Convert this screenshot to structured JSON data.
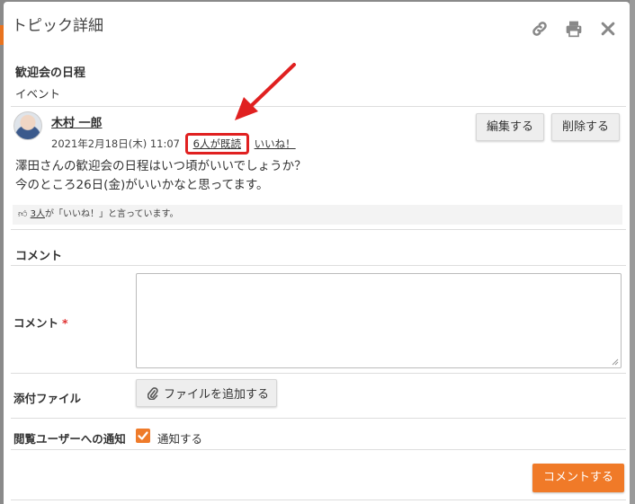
{
  "modal": {
    "title": "トピック詳細",
    "icons": [
      "link-icon",
      "print-icon",
      "close-icon"
    ]
  },
  "topic": {
    "title": "歓迎会の日程",
    "category": "イベント"
  },
  "post": {
    "author": "木村 一郎",
    "date": "2021年2月18日(木) 11:07",
    "read_link": "6人が既読",
    "like_link": "いいね！",
    "edit_button": "編集する",
    "delete_button": "削除する",
    "body_line1": "澤田さんの歓迎会の日程はいつ頃がいいでしょうか？",
    "body_line2": "今のところ26日(金)がいいかなと思ってます。",
    "like_count_link": "3人",
    "like_suffix": "が「いいね！」と言っています。"
  },
  "comment_form": {
    "section_title": "コメント",
    "comment_label": "コメント",
    "required_mark": "*",
    "comment_value": "",
    "attach_label": "添付ファイル",
    "attach_button": "ファイルを追加する",
    "notify_label": "閲覧ユーザーへの通知",
    "notify_checkbox_label": "通知する",
    "notify_checked": true,
    "submit_button": "コメントする"
  },
  "colors": {
    "accent": "#f07a28",
    "highlight_box": "#e02020",
    "annotation_arrow": "#e02020"
  }
}
